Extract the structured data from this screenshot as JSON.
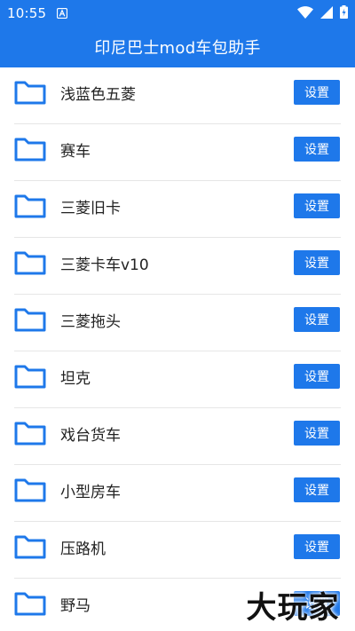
{
  "status_bar": {
    "time": "10:55"
  },
  "header": {
    "title": "印尼巴士mod车包助手"
  },
  "list": {
    "button_label": "设置",
    "items": [
      {
        "label": "浅蓝色五菱"
      },
      {
        "label": "赛车"
      },
      {
        "label": "三菱旧卡"
      },
      {
        "label": "三菱卡车v10"
      },
      {
        "label": "三菱拖头"
      },
      {
        "label": "坦克"
      },
      {
        "label": "戏台货车"
      },
      {
        "label": "小型房车"
      },
      {
        "label": "压路机"
      },
      {
        "label": "野马"
      }
    ]
  },
  "watermark": {
    "text": "大玩家"
  },
  "colors": {
    "accent": "#1e78ea",
    "divider": "#e6e6e6"
  }
}
